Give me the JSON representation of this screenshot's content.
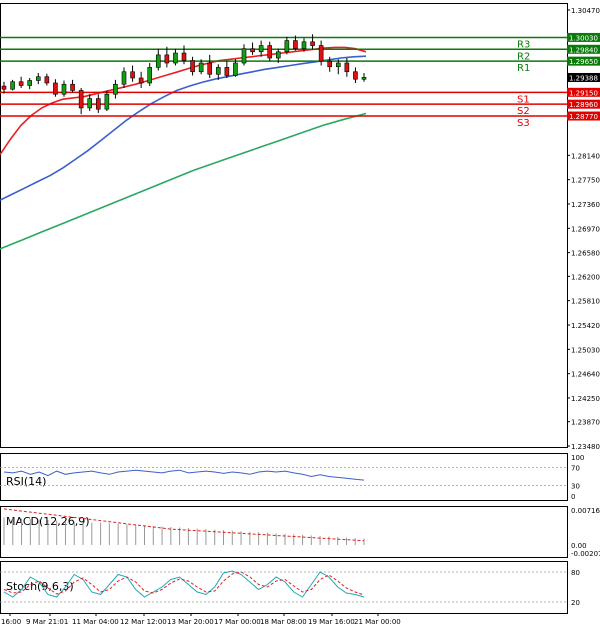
{
  "panels": {
    "rsi": {
      "label": "RSI(14)",
      "ticks": [
        "100",
        "70",
        "30",
        "0"
      ]
    },
    "macd": {
      "label": "MACD(12,26,9)",
      "ticks": [
        "0.007166",
        "0.00",
        "-0.002074"
      ]
    },
    "stoch": {
      "label": "Stoch(9,6,3)",
      "ticks": [
        "80",
        "20"
      ]
    }
  },
  "colors": {
    "resistance": "#0a7a0a",
    "support": "#e00000",
    "ma_fast": "#e82020",
    "ma_mid": "#3a5fd0",
    "ma_slow": "#2aa860",
    "candle_up": "#12a012",
    "candle_down": "#dd1111",
    "stoch_main": "#20a8b8",
    "stoch_signal": "#dd2020",
    "macd_signal": "#dd2020"
  },
  "chart_data": {
    "type": "candlestick",
    "y_ticks": [
      "1.30470",
      "1.30030",
      "1.29840",
      "1.29650",
      "1.29388",
      "1.29150",
      "1.28960",
      "1.28770",
      "1.28140",
      "1.27750",
      "1.27360",
      "1.26970",
      "1.26580",
      "1.26200",
      "1.25810",
      "1.25420",
      "1.25030",
      "1.24640",
      "1.24250",
      "1.23870",
      "1.23480"
    ],
    "ylim": [
      1.2348,
      1.3047
    ],
    "x_labels": [
      "16:00",
      "9 Mar 21:01",
      "11 Mar 04:00",
      "12 Mar 12:00",
      "13 Mar 20:00",
      "17 Mar 00:00",
      "18 Mar 08:00",
      "19 Mar 16:00",
      "21 Mar 00:00"
    ],
    "current_price": "1.29388",
    "levels": [
      {
        "name": "R3",
        "value": 1.3003,
        "label": "1.30030",
        "kind": "resistance"
      },
      {
        "name": "R2",
        "value": 1.2984,
        "label": "1.29840",
        "kind": "resistance"
      },
      {
        "name": "R1",
        "value": 1.2965,
        "label": "1.29650",
        "kind": "resistance"
      },
      {
        "name": "S1",
        "value": 1.2915,
        "label": "1.29150",
        "kind": "support"
      },
      {
        "name": "S2",
        "value": 1.2896,
        "label": "1.28960",
        "kind": "support"
      },
      {
        "name": "S3",
        "value": 1.2877,
        "label": "1.28770",
        "kind": "support"
      }
    ],
    "candles": [
      [
        1.2925,
        1.2932,
        1.2913,
        1.292
      ],
      [
        1.292,
        1.2935,
        1.2918,
        1.2932
      ],
      [
        1.2932,
        1.294,
        1.2922,
        1.2926
      ],
      [
        1.2926,
        1.2938,
        1.292,
        1.2934
      ],
      [
        1.2934,
        1.2946,
        1.2928,
        1.294
      ],
      [
        1.294,
        1.2945,
        1.2926,
        1.293
      ],
      [
        1.293,
        1.2936,
        1.2908,
        1.2912
      ],
      [
        1.2912,
        1.2934,
        1.2908,
        1.2928
      ],
      [
        1.2928,
        1.2935,
        1.2915,
        1.2918
      ],
      [
        1.2918,
        1.2922,
        1.288,
        1.289
      ],
      [
        1.289,
        1.2912,
        1.2885,
        1.2905
      ],
      [
        1.2905,
        1.2912,
        1.2882,
        1.2888
      ],
      [
        1.2888,
        1.2918,
        1.2885,
        1.2912
      ],
      [
        1.2912,
        1.2935,
        1.2905,
        1.2928
      ],
      [
        1.2928,
        1.2955,
        1.2922,
        1.2948
      ],
      [
        1.2948,
        1.2958,
        1.2932,
        1.2938
      ],
      [
        1.2938,
        1.2948,
        1.2922,
        1.293
      ],
      [
        1.293,
        1.2962,
        1.2925,
        1.2955
      ],
      [
        1.2955,
        1.2985,
        1.295,
        1.2975
      ],
      [
        1.2975,
        1.2988,
        1.2955,
        1.2962
      ],
      [
        1.2962,
        1.2985,
        1.2958,
        1.2978
      ],
      [
        1.2978,
        1.299,
        1.296,
        1.2966
      ],
      [
        1.2966,
        1.2972,
        1.2942,
        1.2948
      ],
      [
        1.2948,
        1.2968,
        1.2944,
        1.2962
      ],
      [
        1.2962,
        1.2975,
        1.2938,
        1.2944
      ],
      [
        1.2944,
        1.296,
        1.2935,
        1.2955
      ],
      [
        1.2955,
        1.2965,
        1.2938,
        1.2942
      ],
      [
        1.2942,
        1.2968,
        1.294,
        1.2962
      ],
      [
        1.2962,
        1.2992,
        1.2958,
        1.2985
      ],
      [
        1.2985,
        1.2995,
        1.2975,
        1.298
      ],
      [
        1.298,
        1.2998,
        1.2972,
        1.299
      ],
      [
        1.299,
        1.2996,
        1.2965,
        1.297
      ],
      [
        1.297,
        1.2985,
        1.2962,
        1.298
      ],
      [
        1.298,
        1.3004,
        1.2976,
        1.2998
      ],
      [
        1.2998,
        1.3006,
        1.2982,
        1.2985
      ],
      [
        1.2985,
        1.3002,
        1.298,
        1.2996
      ],
      [
        1.2996,
        1.3008,
        1.2984,
        1.299
      ],
      [
        1.299,
        1.2998,
        1.2958,
        1.2965
      ],
      [
        1.2965,
        1.2972,
        1.2948,
        1.2956
      ],
      [
        1.2956,
        1.2968,
        1.2944,
        1.2962
      ],
      [
        1.2962,
        1.297,
        1.294,
        1.2948
      ],
      [
        1.2948,
        1.2955,
        1.293,
        1.2936
      ],
      [
        1.2936,
        1.2946,
        1.2932,
        1.2939
      ]
    ],
    "ma_fast": [
      1.2815,
      1.284,
      1.2862,
      1.2878,
      1.289,
      1.2898,
      1.2904,
      1.2906,
      1.2908,
      1.2912,
      1.2916,
      1.292,
      1.2924,
      1.2928,
      1.2933,
      1.2938,
      1.2943,
      1.2948,
      1.2953,
      1.2958,
      1.2962,
      1.2966,
      1.2968,
      1.297,
      1.2972,
      1.2974,
      1.2976,
      1.2978,
      1.298,
      1.2982,
      1.2984,
      1.2986,
      1.2987,
      1.2987,
      1.2985,
      1.298
    ],
    "ma_mid": [
      1.2742,
      1.2752,
      1.2762,
      1.2772,
      1.2782,
      1.2794,
      1.2808,
      1.2822,
      1.2838,
      1.2854,
      1.287,
      1.2884,
      1.2897,
      1.2908,
      1.2918,
      1.2925,
      1.2931,
      1.2936,
      1.294,
      1.2944,
      1.2948,
      1.2952,
      1.2955,
      1.2958,
      1.2961,
      1.2964,
      1.2967,
      1.297,
      1.2972,
      1.2973
    ],
    "ma_slow": [
      1.2664,
      1.2678,
      1.2692,
      1.2706,
      1.272,
      1.2734,
      1.2748,
      1.2762,
      1.2776,
      1.279,
      1.2802,
      1.2814,
      1.2826,
      1.2838,
      1.285,
      1.2862,
      1.2872,
      1.2881
    ],
    "rsi": [
      60,
      58,
      62,
      55,
      60,
      52,
      62,
      55,
      58,
      60,
      62,
      58,
      55,
      60,
      62,
      64,
      62,
      60,
      58,
      62,
      64,
      58,
      60,
      62,
      60,
      57,
      60,
      58,
      55,
      60,
      62,
      60,
      62,
      58,
      55,
      50,
      54,
      50,
      48,
      46,
      44,
      42
    ],
    "macd_hist": [
      0.0052,
      0.0051,
      0.005,
      0.0049,
      0.0048,
      0.0047,
      0.0046,
      0.0045,
      0.0044,
      0.0043,
      0.0042,
      0.0042,
      0.0041,
      0.004,
      0.0039,
      0.0038,
      0.0037,
      0.0036,
      0.0035,
      0.0034,
      0.0033,
      0.0032,
      0.0031,
      0.003,
      0.0029,
      0.0028,
      0.0027,
      0.0026,
      0.0025,
      0.0024,
      0.0023,
      0.0022,
      0.0021,
      0.002,
      0.0019,
      0.0018,
      0.0017,
      0.0016,
      0.0015,
      0.0014,
      0.0013,
      0.0012
    ],
    "macd_signal": [
      0.0068,
      0.0066,
      0.0064,
      0.0062,
      0.006,
      0.0058,
      0.0056,
      0.0054,
      0.0052,
      0.005,
      0.0048,
      0.0046,
      0.0044,
      0.0042,
      0.004,
      0.0038,
      0.0036,
      0.0034,
      0.0032,
      0.003,
      0.0029,
      0.0028,
      0.0027,
      0.0026,
      0.0025,
      0.0024,
      0.0023,
      0.0022,
      0.0021,
      0.002,
      0.0019,
      0.0018,
      0.0017,
      0.0016,
      0.0015,
      0.0014,
      0.0013,
      0.0012,
      0.0011,
      0.001,
      0.0009,
      0.0008
    ],
    "stoch_main": [
      40,
      30,
      45,
      70,
      60,
      35,
      30,
      50,
      75,
      65,
      40,
      35,
      55,
      75,
      70,
      45,
      30,
      40,
      50,
      65,
      70,
      55,
      40,
      35,
      50,
      78,
      82,
      75,
      60,
      45,
      55,
      70,
      60,
      40,
      30,
      55,
      80,
      70,
      50,
      38,
      35,
      30
    ],
    "stoch_signal": [
      45,
      38,
      40,
      55,
      62,
      48,
      36,
      42,
      60,
      68,
      55,
      40,
      45,
      62,
      70,
      60,
      42,
      38,
      45,
      58,
      66,
      62,
      50,
      40,
      42,
      62,
      76,
      80,
      70,
      55,
      50,
      62,
      65,
      52,
      40,
      45,
      65,
      74,
      62,
      48,
      40,
      34
    ]
  }
}
